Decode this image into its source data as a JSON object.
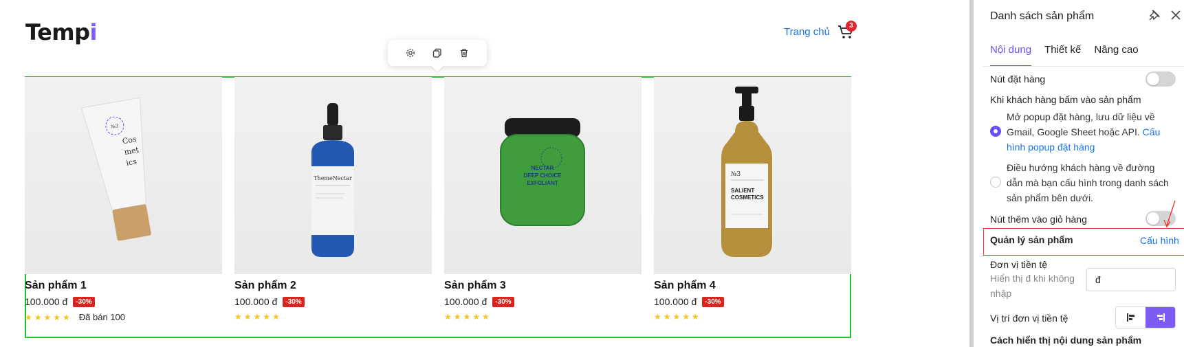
{
  "header": {
    "logo_main": "Temp",
    "logo_accent": "i",
    "nav_home": "Trang chủ",
    "cart_count": "3"
  },
  "toolbar": {
    "icons": [
      "gear-icon",
      "copy-icon",
      "trash-icon"
    ]
  },
  "products": [
    {
      "name": "Sản phẩm 1",
      "price": "100.000 đ",
      "discount": "-30%",
      "stars": "★★★★★",
      "sold": "Đã bán 100"
    },
    {
      "name": "Sản phẩm 2",
      "price": "100.000 đ",
      "discount": "-30%",
      "stars": "★★★★★",
      "sold": ""
    },
    {
      "name": "Sản phẩm 3",
      "price": "100.000 đ",
      "discount": "-30%",
      "stars": "★★★★★",
      "sold": ""
    },
    {
      "name": "Sản phẩm 4",
      "price": "100.000 đ",
      "discount": "-30%",
      "stars": "★★★★★",
      "sold": ""
    }
  ],
  "product_labels": {
    "p1": [
      "Cos",
      "met",
      "ics"
    ],
    "p2": "ThemeNectar",
    "p3": [
      "NECTAR",
      "DEEP CHOICE",
      "EXFOLIANT"
    ],
    "p4": [
      "№3",
      "SALIENT",
      "COSMETICS"
    ]
  },
  "panel": {
    "title": "Danh sách sản phẩm",
    "tabs": [
      "Nội dung",
      "Thiết kế",
      "Nâng cao"
    ],
    "order_button_label": "Nút đặt hàng",
    "order_button_on": false,
    "click_behavior_label": "Khi khách hàng bấm vào sản phẩm",
    "option1_text": "Mở popup đặt hàng, lưu dữ liệu về Gmail, Google Sheet hoặc API.",
    "option1_link": "Cấu hình popup đặt hàng",
    "option2_text": "Điều hướng khách hàng về đường dẫn mà bạn cấu hình trong danh sách sản phẩm bên dưới.",
    "selected_option": 1,
    "add_to_cart_label": "Nút thêm vào giỏ hàng",
    "add_to_cart_on": false,
    "manage_products_label": "Quản lý sản phẩm",
    "manage_products_link": "Cấu hình",
    "currency_label": "Đơn vị tiền tệ",
    "currency_sub": "Hiển thị đ khi không nhập",
    "currency_value": "đ",
    "currency_position_label": "Vị trí đơn vị tiền tệ",
    "display_content_label": "Cách hiển thị nội dung sản phẩm"
  },
  "colors": {
    "accent": "#6a4ff2",
    "link": "#1a73e8",
    "selection": "#22c02a",
    "discount": "#d9251d",
    "star": "#f5c518"
  }
}
